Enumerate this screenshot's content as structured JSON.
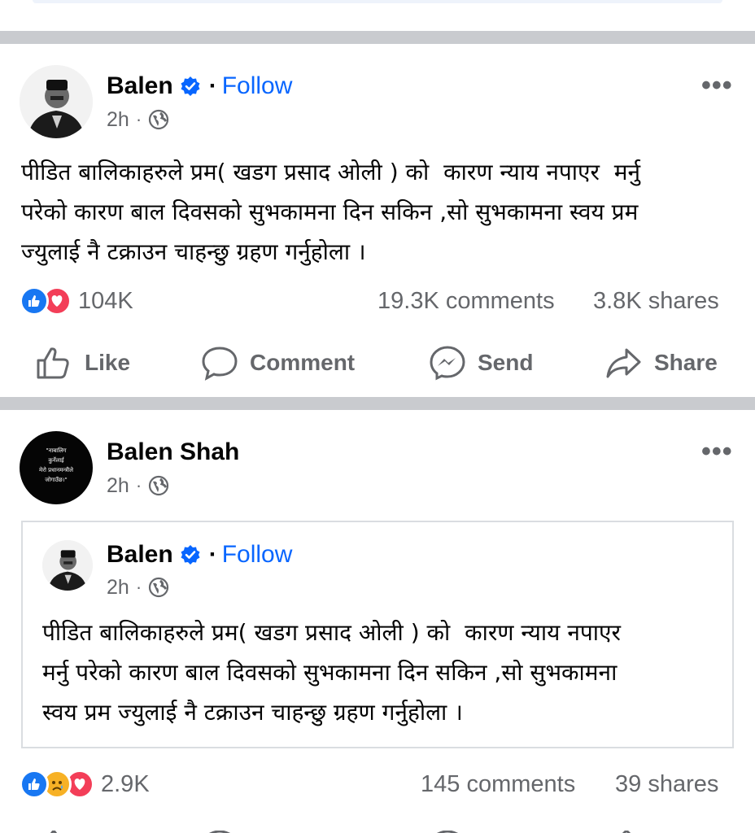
{
  "post1": {
    "author": "Balen",
    "verified": true,
    "separator": "·",
    "follow_label": "Follow",
    "time": "2h",
    "meta_dot": "·",
    "privacy_icon": "globe-icon",
    "text": "पीडित बालिकाहरुले प्रम( खडग प्रसाद ओली ) को  कारण न्याय नपाएर  मर्नु\nपरेको कारण बाल दिवसको सुभकामना दिन सकिन ,सो सुभकामना स्वय प्रम\nज्युलाई नै टक्राउन चाहन्छु ग्रहण गर्नुहोला ।",
    "reactions_count": "104K",
    "reaction_icons": [
      "like-icon",
      "love-icon"
    ],
    "comments": "19.3K comments",
    "shares": "3.8K shares",
    "actions": {
      "like": "Like",
      "comment": "Comment",
      "send": "Send",
      "share": "Share"
    },
    "more": "•••"
  },
  "post2": {
    "author": "Balen Shah",
    "time": "2h",
    "meta_dot": "·",
    "avatar_text": "\"नाबालिग\nकुर्नेलाई\nमेरो प्रधानमन्त्रीले\nजोगाउँछ।\"",
    "more": "•••",
    "shared": {
      "author": "Balen",
      "verified": true,
      "separator": "·",
      "follow_label": "Follow",
      "time": "2h",
      "meta_dot": "·",
      "text": "पीडित बालिकाहरुले प्रम( खडग प्रसाद ओली ) को  कारण न्याय नपाएर\nमर्नु परेको कारण बाल दिवसको सुभकामना दिन सकिन ,सो सुभकामना\nस्वय प्रम ज्युलाई नै टक्राउन चाहन्छु ग्रहण गर्नुहोला ।"
    },
    "reactions_count": "2.9K",
    "reaction_icons": [
      "like-icon",
      "sad-icon",
      "love-icon"
    ],
    "comments": "145 comments",
    "shares": "39 shares"
  },
  "colors": {
    "accent": "#0866ff",
    "separator": "#c9cbcf",
    "secondary_text": "#65676b",
    "love": "#f33e58",
    "haha": "#f7b125"
  }
}
